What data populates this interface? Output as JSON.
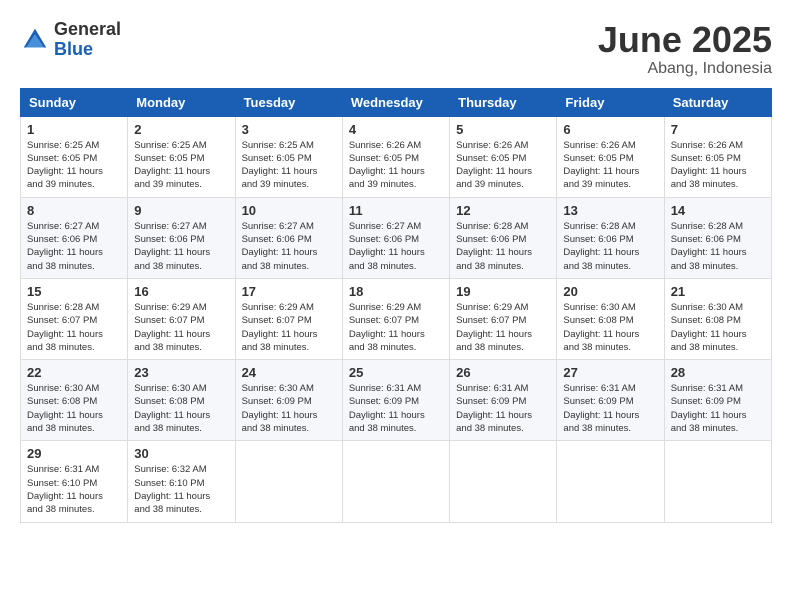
{
  "header": {
    "logo_general": "General",
    "logo_blue": "Blue",
    "month_title": "June 2025",
    "location": "Abang, Indonesia"
  },
  "days_of_week": [
    "Sunday",
    "Monday",
    "Tuesday",
    "Wednesday",
    "Thursday",
    "Friday",
    "Saturday"
  ],
  "weeks": [
    [
      {
        "day": 1,
        "sunrise": "6:25 AM",
        "sunset": "6:05 PM",
        "daylight": "11 hours and 39 minutes"
      },
      {
        "day": 2,
        "sunrise": "6:25 AM",
        "sunset": "6:05 PM",
        "daylight": "11 hours and 39 minutes"
      },
      {
        "day": 3,
        "sunrise": "6:25 AM",
        "sunset": "6:05 PM",
        "daylight": "11 hours and 39 minutes"
      },
      {
        "day": 4,
        "sunrise": "6:26 AM",
        "sunset": "6:05 PM",
        "daylight": "11 hours and 39 minutes"
      },
      {
        "day": 5,
        "sunrise": "6:26 AM",
        "sunset": "6:05 PM",
        "daylight": "11 hours and 39 minutes"
      },
      {
        "day": 6,
        "sunrise": "6:26 AM",
        "sunset": "6:05 PM",
        "daylight": "11 hours and 39 minutes"
      },
      {
        "day": 7,
        "sunrise": "6:26 AM",
        "sunset": "6:05 PM",
        "daylight": "11 hours and 38 minutes"
      }
    ],
    [
      {
        "day": 8,
        "sunrise": "6:27 AM",
        "sunset": "6:06 PM",
        "daylight": "11 hours and 38 minutes"
      },
      {
        "day": 9,
        "sunrise": "6:27 AM",
        "sunset": "6:06 PM",
        "daylight": "11 hours and 38 minutes"
      },
      {
        "day": 10,
        "sunrise": "6:27 AM",
        "sunset": "6:06 PM",
        "daylight": "11 hours and 38 minutes"
      },
      {
        "day": 11,
        "sunrise": "6:27 AM",
        "sunset": "6:06 PM",
        "daylight": "11 hours and 38 minutes"
      },
      {
        "day": 12,
        "sunrise": "6:28 AM",
        "sunset": "6:06 PM",
        "daylight": "11 hours and 38 minutes"
      },
      {
        "day": 13,
        "sunrise": "6:28 AM",
        "sunset": "6:06 PM",
        "daylight": "11 hours and 38 minutes"
      },
      {
        "day": 14,
        "sunrise": "6:28 AM",
        "sunset": "6:06 PM",
        "daylight": "11 hours and 38 minutes"
      }
    ],
    [
      {
        "day": 15,
        "sunrise": "6:28 AM",
        "sunset": "6:07 PM",
        "daylight": "11 hours and 38 minutes"
      },
      {
        "day": 16,
        "sunrise": "6:29 AM",
        "sunset": "6:07 PM",
        "daylight": "11 hours and 38 minutes"
      },
      {
        "day": 17,
        "sunrise": "6:29 AM",
        "sunset": "6:07 PM",
        "daylight": "11 hours and 38 minutes"
      },
      {
        "day": 18,
        "sunrise": "6:29 AM",
        "sunset": "6:07 PM",
        "daylight": "11 hours and 38 minutes"
      },
      {
        "day": 19,
        "sunrise": "6:29 AM",
        "sunset": "6:07 PM",
        "daylight": "11 hours and 38 minutes"
      },
      {
        "day": 20,
        "sunrise": "6:30 AM",
        "sunset": "6:08 PM",
        "daylight": "11 hours and 38 minutes"
      },
      {
        "day": 21,
        "sunrise": "6:30 AM",
        "sunset": "6:08 PM",
        "daylight": "11 hours and 38 minutes"
      }
    ],
    [
      {
        "day": 22,
        "sunrise": "6:30 AM",
        "sunset": "6:08 PM",
        "daylight": "11 hours and 38 minutes"
      },
      {
        "day": 23,
        "sunrise": "6:30 AM",
        "sunset": "6:08 PM",
        "daylight": "11 hours and 38 minutes"
      },
      {
        "day": 24,
        "sunrise": "6:30 AM",
        "sunset": "6:09 PM",
        "daylight": "11 hours and 38 minutes"
      },
      {
        "day": 25,
        "sunrise": "6:31 AM",
        "sunset": "6:09 PM",
        "daylight": "11 hours and 38 minutes"
      },
      {
        "day": 26,
        "sunrise": "6:31 AM",
        "sunset": "6:09 PM",
        "daylight": "11 hours and 38 minutes"
      },
      {
        "day": 27,
        "sunrise": "6:31 AM",
        "sunset": "6:09 PM",
        "daylight": "11 hours and 38 minutes"
      },
      {
        "day": 28,
        "sunrise": "6:31 AM",
        "sunset": "6:09 PM",
        "daylight": "11 hours and 38 minutes"
      }
    ],
    [
      {
        "day": 29,
        "sunrise": "6:31 AM",
        "sunset": "6:10 PM",
        "daylight": "11 hours and 38 minutes"
      },
      {
        "day": 30,
        "sunrise": "6:32 AM",
        "sunset": "6:10 PM",
        "daylight": "11 hours and 38 minutes"
      },
      null,
      null,
      null,
      null,
      null
    ]
  ]
}
